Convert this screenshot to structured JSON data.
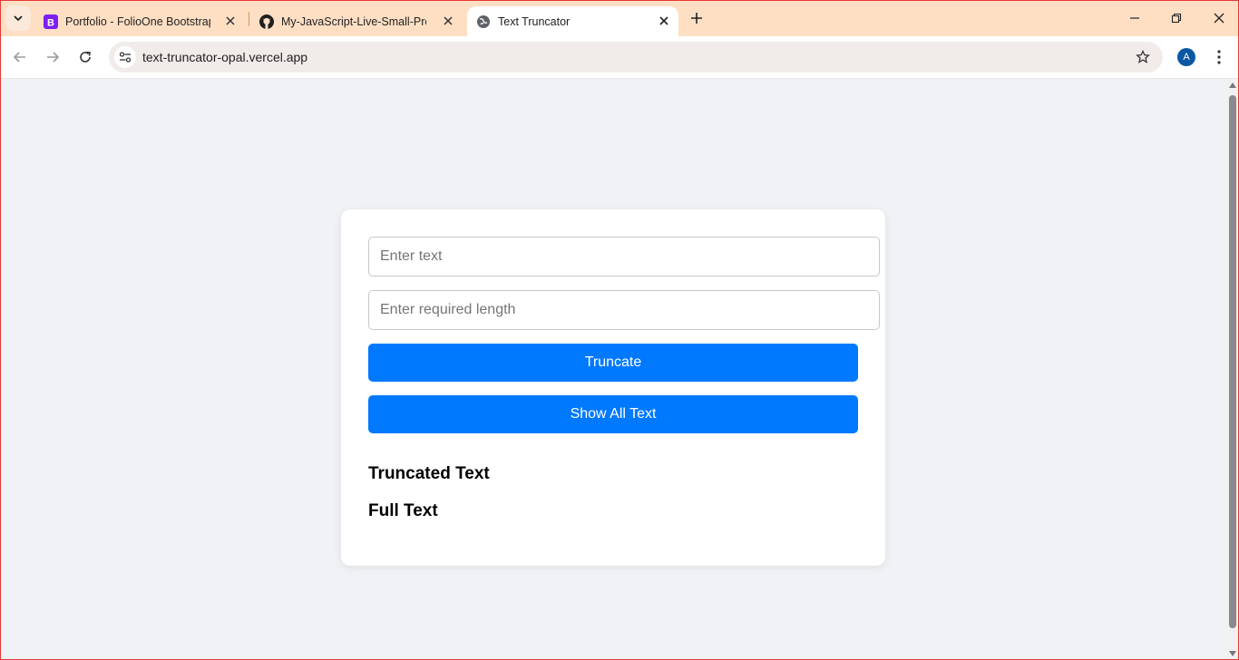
{
  "browser": {
    "tabs": [
      {
        "title": "Portfolio - FolioOne Bootstrap T",
        "favicon": "bootstrap-icon"
      },
      {
        "title": "My-JavaScript-Live-Small-Proje",
        "favicon": "github-icon"
      },
      {
        "title": "Text Truncator",
        "favicon": "globe-icon",
        "active": true
      }
    ],
    "url": "text-truncator-opal.vercel.app",
    "profile_initial": "A"
  },
  "colors": {
    "accent": "#0079fe",
    "tabstrip": "#ffdfc4",
    "page_bg": "#f0f2f5"
  },
  "form": {
    "text_placeholder": "Enter text",
    "length_placeholder": "Enter required length",
    "truncate_label": "Truncate",
    "show_all_label": "Show All Text"
  },
  "output": {
    "truncated_heading": "Truncated Text",
    "full_heading": "Full Text"
  }
}
